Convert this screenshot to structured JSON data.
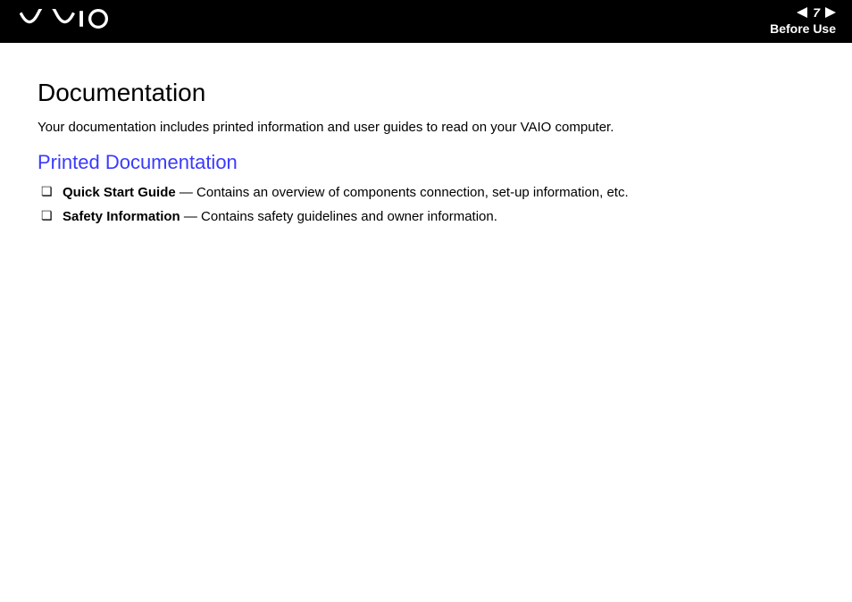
{
  "header": {
    "page_number": "7",
    "section": "Before Use"
  },
  "content": {
    "title": "Documentation",
    "intro": "Your documentation includes printed information and user guides to read on your VAIO computer.",
    "subheading": "Printed Documentation",
    "items": [
      {
        "name": "Quick Start Guide",
        "sep": " — ",
        "desc": "Contains an overview of components connection, set-up information, etc."
      },
      {
        "name": "Safety Information",
        "sep": " — ",
        "desc": "Contains safety guidelines and owner information."
      }
    ]
  }
}
